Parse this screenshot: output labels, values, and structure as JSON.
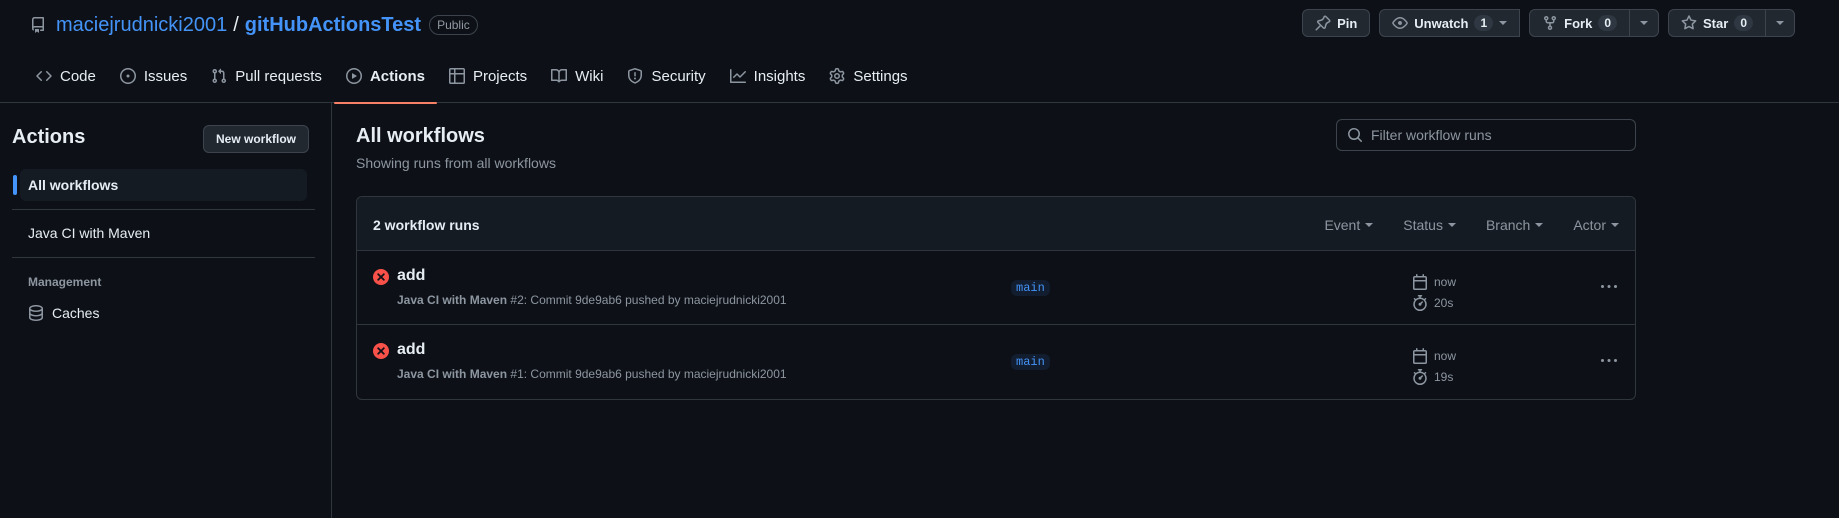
{
  "repo": {
    "owner": "maciejrudnicki2001",
    "separator": "/",
    "name": "gitHubActionsTest",
    "visibility": "Public"
  },
  "repo_actions": {
    "pin_label": "Pin",
    "unwatch_label": "Unwatch",
    "watch_count": "1",
    "fork_label": "Fork",
    "fork_count": "0",
    "star_label": "Star",
    "star_count": "0"
  },
  "nav": {
    "items": [
      {
        "label": "Code",
        "icon": "code-icon"
      },
      {
        "label": "Issues",
        "icon": "issue-opened-icon"
      },
      {
        "label": "Pull requests",
        "icon": "git-pull-request-icon"
      },
      {
        "label": "Actions",
        "icon": "play-icon",
        "active": true
      },
      {
        "label": "Projects",
        "icon": "table-icon"
      },
      {
        "label": "Wiki",
        "icon": "book-icon"
      },
      {
        "label": "Security",
        "icon": "shield-icon"
      },
      {
        "label": "Insights",
        "icon": "graph-icon"
      },
      {
        "label": "Settings",
        "icon": "gear-icon"
      }
    ]
  },
  "sidebar": {
    "title": "Actions",
    "new_workflow_label": "New workflow",
    "all_workflows_label": "All workflows",
    "workflow_label": "Java CI with Maven",
    "management_heading": "Management",
    "caches_label": "Caches"
  },
  "main": {
    "title": "All workflows",
    "subtitle": "Showing runs from all workflows",
    "filter_placeholder": "Filter workflow runs",
    "runs_count": "2 workflow runs",
    "filters": {
      "event": "Event",
      "status": "Status",
      "branch": "Branch",
      "actor": "Actor"
    },
    "runs": [
      {
        "title": "add",
        "workflow": "Java CI with Maven",
        "run_number": "#2",
        "detail": ": Commit 9de9ab6 pushed by maciejrudnicki2001",
        "branch": "main",
        "time": "now",
        "duration": "20s",
        "status": "failure"
      },
      {
        "title": "add",
        "workflow": "Java CI with Maven",
        "run_number": "#1",
        "detail": ": Commit 9de9ab6 pushed by maciejrudnicki2001",
        "branch": "main",
        "time": "now",
        "duration": "19s",
        "status": "failure"
      }
    ]
  },
  "colors": {
    "background": "#0d1117",
    "accent_link": "#4493f8",
    "active_tab_underline": "#f78166",
    "failure": "#f85149"
  }
}
